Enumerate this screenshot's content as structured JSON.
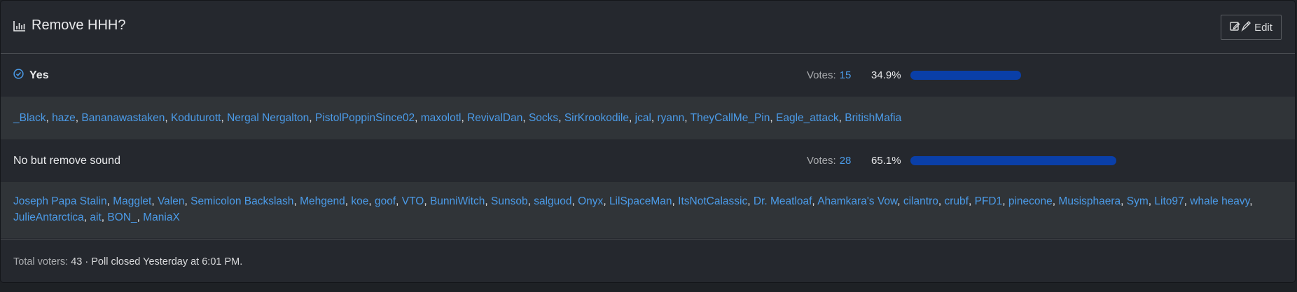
{
  "poll": {
    "title": "Remove HHH?",
    "edit_label": "Edit",
    "votes_label": "Votes:",
    "options": [
      {
        "label": "Yes",
        "votes": "15",
        "percent": "34.9%",
        "fraction": 0.349,
        "selected": true,
        "voters": [
          "_Black",
          "haze",
          "Bananawastaken",
          "Koduturott",
          "Nergal Nergalton",
          "PistolPoppinSince02",
          "maxolotl",
          "RevivalDan",
          "Socks",
          "SirKrookodile",
          "jcal",
          "ryann",
          "TheyCallMe_Pin",
          "Eagle_attack",
          "BritishMafia"
        ]
      },
      {
        "label": "No but remove sound",
        "votes": "28",
        "percent": "65.1%",
        "fraction": 0.651,
        "selected": false,
        "voters": [
          "Joseph Papa Stalin",
          "Magglet",
          "Valen",
          "Semicolon Backslash",
          "Mehgend",
          "koe",
          "goof",
          "VTO",
          "BunniWitch",
          "Sunsob",
          "salguod",
          "Onyx",
          "LilSpaceMan",
          "ItsNotCalassic",
          "Dr. Meatloaf",
          "Ahamkara's Vow",
          "cilantro",
          "crubf",
          "PFD1",
          "pinecone",
          "Musisphaera",
          "Sym",
          "Lito97",
          "whale heavy",
          "JulieAntarctica",
          "ait",
          "BON_",
          "ManiaX"
        ]
      }
    ],
    "footer": {
      "total_label": "Total voters:",
      "total_value": "43",
      "status": "· Poll closed Yesterday at 6:01 PM."
    },
    "colors": {
      "accent": "#4b9be8",
      "bar": "#0a3fa8",
      "panel": "#25282e",
      "voters_bg": "#303438"
    }
  }
}
